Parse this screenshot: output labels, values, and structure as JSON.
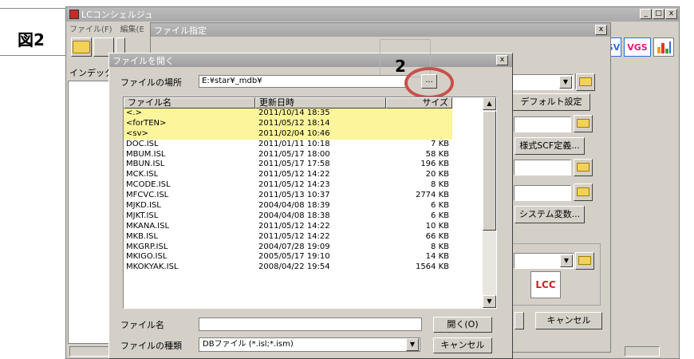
{
  "figure_label": "図2",
  "main": {
    "title": "LCコンシェルジュ",
    "menu": [
      "ファイル(F)",
      "編集(E"
    ],
    "index_label": "インデックス",
    "toolbar_icons": [
      "SV",
      "VGS",
      "chart-icon"
    ],
    "win_buttons": [
      "_",
      "□",
      "x"
    ]
  },
  "spec_dialog": {
    "title": "ファイル指定",
    "buttons": {
      "default": "デフォルト設定",
      "style": "様式SCF定義...",
      "sysvar": "システム変数...",
      "cancel": "キャンセル"
    },
    "lcc_label": "LCC"
  },
  "open_dialog": {
    "title": "ファイルを開く",
    "location_label": "ファイルの場所",
    "location_value": "E:¥star¥_mdb¥",
    "browse_label": "...",
    "callout": "2",
    "columns": [
      "ファイル名",
      "更新日時",
      "サイズ"
    ],
    "rows": [
      {
        "name": "<.>",
        "date": "2011/10/14 18:35",
        "size": "",
        "highlight": true
      },
      {
        "name": "<forTEN>",
        "date": "2011/05/12 18:14",
        "size": "",
        "highlight": true
      },
      {
        "name": "<sv>",
        "date": "2011/02/04 10:46",
        "size": "",
        "highlight": true
      },
      {
        "name": "DOC.ISL",
        "date": "2011/01/11 10:18",
        "size": "7 KB"
      },
      {
        "name": "MBUM.ISL",
        "date": "2011/05/17 18:00",
        "size": "58 KB"
      },
      {
        "name": "MBUN.ISL",
        "date": "2011/05/17 17:58",
        "size": "196 KB"
      },
      {
        "name": "MCK.ISL",
        "date": "2011/05/12 14:22",
        "size": "20 KB"
      },
      {
        "name": "MCODE.ISL",
        "date": "2011/05/12 14:23",
        "size": "8 KB"
      },
      {
        "name": "MFCVC.ISL",
        "date": "2011/05/13 10:37",
        "size": "2774 KB"
      },
      {
        "name": "MJKD.ISL",
        "date": "2004/04/08 18:39",
        "size": "6 KB"
      },
      {
        "name": "MJKT.ISL",
        "date": "2004/04/08 18:38",
        "size": "6 KB"
      },
      {
        "name": "MKANA.ISL",
        "date": "2011/05/12 14:22",
        "size": "10 KB"
      },
      {
        "name": "MKB.ISL",
        "date": "2011/05/12 14:22",
        "size": "66 KB"
      },
      {
        "name": "MKGRP.ISL",
        "date": "2004/07/28 19:09",
        "size": "8 KB"
      },
      {
        "name": "MKIGO.ISL",
        "date": "2005/05/17 19:10",
        "size": "14 KB"
      },
      {
        "name": "MKOKYAK.ISL",
        "date": "2008/04/22 19:54",
        "size": "1564 KB"
      }
    ],
    "filename_label": "ファイル名",
    "filename_value": "",
    "filetype_label": "ファイルの種類",
    "filetype_value": "DBファイル (*.isl;*.ism)",
    "open_button": "開く(O)",
    "cancel_button": "キャンセル",
    "close_button": "x"
  },
  "colors": {
    "highlight_row": "#fcf59b",
    "callout_ring": "#c8504a",
    "window_face": "#d4d0c8"
  }
}
